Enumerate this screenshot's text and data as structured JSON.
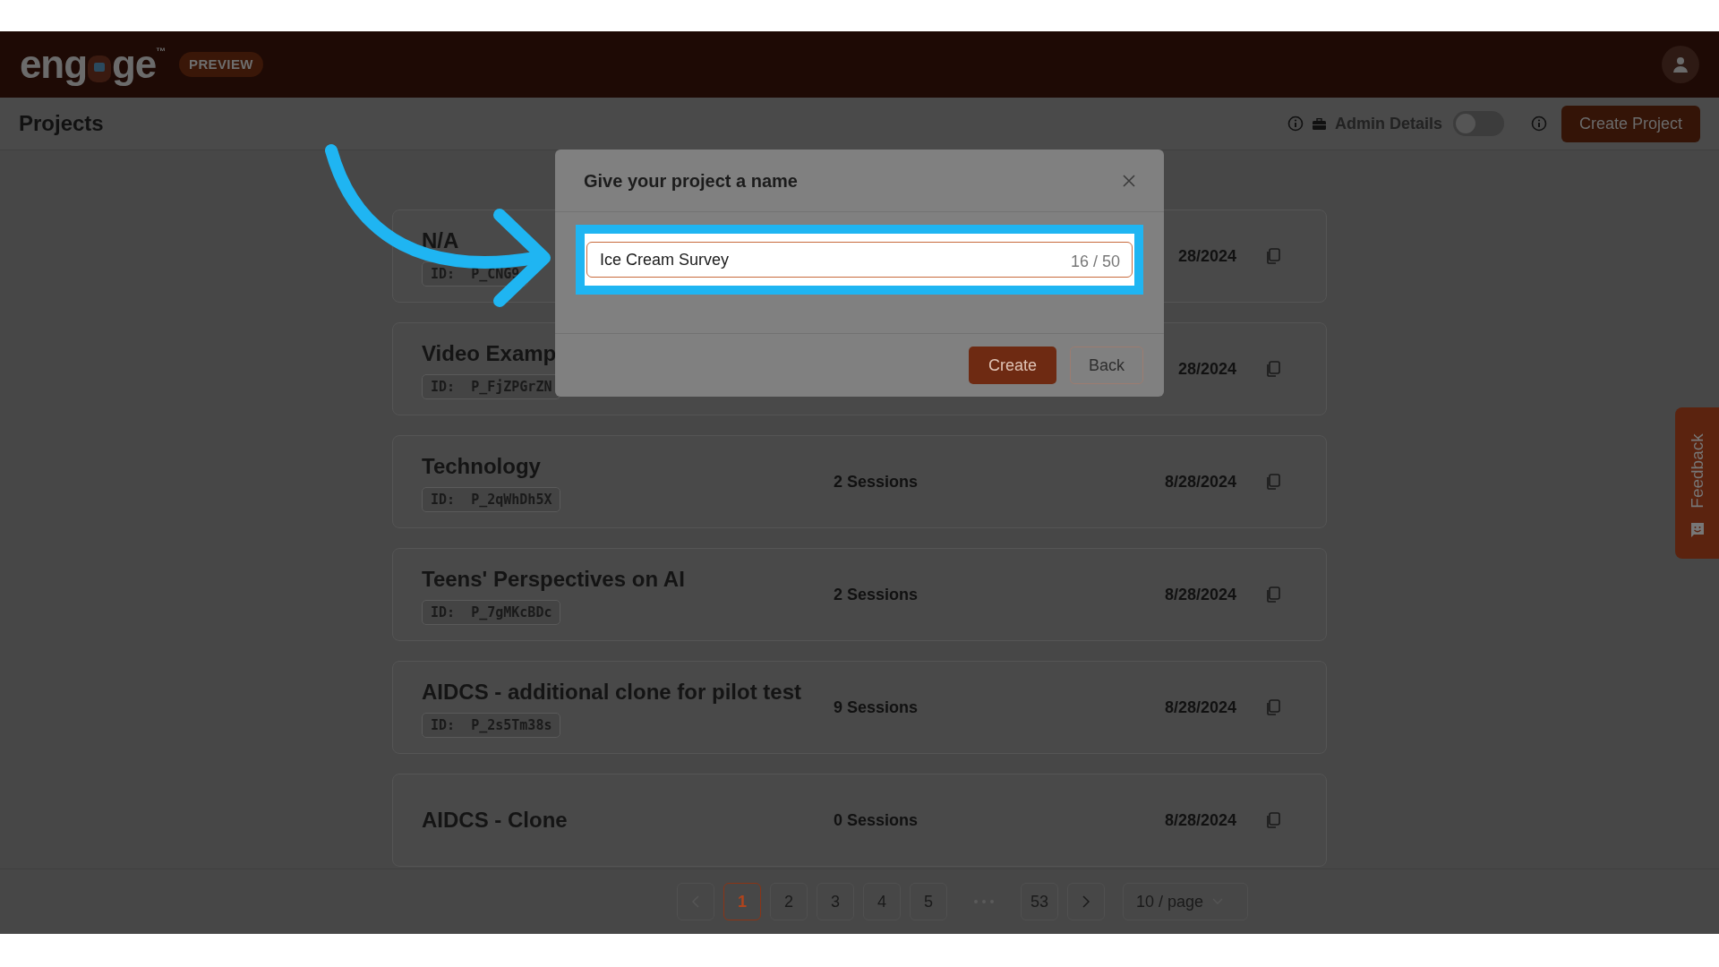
{
  "header": {
    "logo_start": "eng",
    "logo_end": "ge",
    "trademark": "™",
    "badge": "PREVIEW"
  },
  "toolbar": {
    "title": "Projects",
    "admin_label": "Admin Details",
    "admin_toggle": {
      "on": false
    },
    "create_button": "Create Project"
  },
  "projects": [
    {
      "title": "N/A",
      "id_label": "ID:",
      "id": "P_CNG9",
      "date": "28/2024"
    },
    {
      "title": "Video Examp",
      "id_label": "ID:",
      "id": "P_FjZPGrZN",
      "date": "28/2024"
    },
    {
      "title": "Technology",
      "id_label": "ID:",
      "id": "P_2qWhDh5X",
      "sessions_count": "2",
      "sessions_label": "Sessions",
      "date": "8/28/2024"
    },
    {
      "title": "Teens' Perspectives on AI",
      "id_label": "ID:",
      "id": "P_7gMKcBDc",
      "sessions_count": "2",
      "sessions_label": "Sessions",
      "date": "8/28/2024"
    },
    {
      "title": "AIDCS - additional clone for pilot test",
      "id_label": "ID:",
      "id": "P_2s5Tm38s",
      "sessions_count": "9",
      "sessions_label": "Sessions",
      "date": "8/28/2024"
    },
    {
      "title": "AIDCS - Clone",
      "sessions_count": "0",
      "sessions_label": "Sessions",
      "date": "8/28/2024"
    }
  ],
  "pagination": {
    "pages": [
      {
        "label": "1",
        "selected": true
      },
      {
        "label": "2",
        "selected": false
      },
      {
        "label": "3",
        "selected": false
      },
      {
        "label": "4",
        "selected": false
      },
      {
        "label": "5",
        "selected": false
      },
      {
        "label": "53",
        "selected": false
      }
    ],
    "page_size": "10 / page"
  },
  "feedback": "Feedback",
  "dialog": {
    "title": "Give your project a name",
    "value": "Ice Cream Survey",
    "counter": "16 / 50",
    "buttons": [
      "Create",
      "Back"
    ]
  }
}
